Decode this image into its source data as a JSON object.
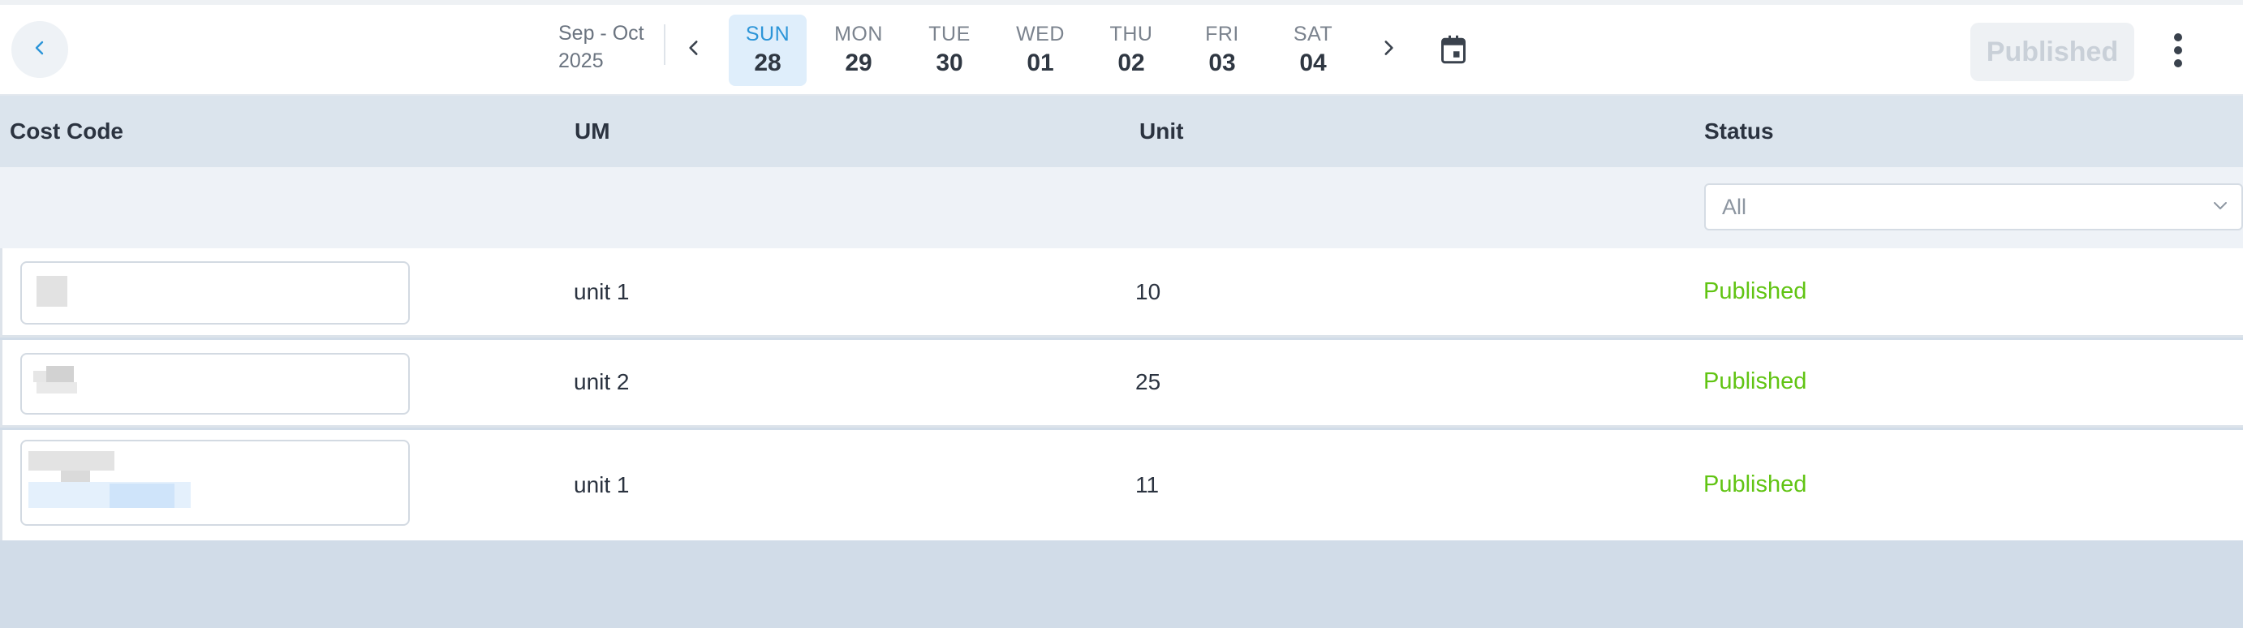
{
  "header": {
    "date_range": {
      "line1": "Sep - Oct",
      "line2": "2025"
    },
    "days": [
      {
        "name": "SUN",
        "date": "28",
        "active": true
      },
      {
        "name": "MON",
        "date": "29",
        "active": false
      },
      {
        "name": "TUE",
        "date": "30",
        "active": false
      },
      {
        "name": "WED",
        "date": "01",
        "active": false
      },
      {
        "name": "THU",
        "date": "02",
        "active": false
      },
      {
        "name": "FRI",
        "date": "03",
        "active": false
      },
      {
        "name": "SAT",
        "date": "04",
        "active": false
      }
    ],
    "publish_label": "Published"
  },
  "table": {
    "columns": [
      "Cost Code",
      "UM",
      "Unit",
      "Status"
    ],
    "status_filter": {
      "selected": "All"
    },
    "rows": [
      {
        "um": "unit 1",
        "unit": "10",
        "status": "Published"
      },
      {
        "um": "unit 2",
        "unit": "25",
        "status": "Published"
      },
      {
        "um": "unit 1",
        "unit": "11",
        "status": "Published"
      }
    ]
  },
  "icons": {
    "back": "chevron-left-icon",
    "prev": "chevron-left-icon",
    "next": "chevron-right-icon",
    "calendar": "calendar-icon",
    "menu": "more-vertical-icon",
    "dropdown": "chevron-down-icon"
  },
  "colors": {
    "accent": "#2c95d8",
    "active_day_bg": "#dfeefb",
    "status_published": "#61c413",
    "header_bg": "#dbe4ed",
    "filter_bg": "#eef2f7",
    "page_bg": "#d1dce8"
  }
}
